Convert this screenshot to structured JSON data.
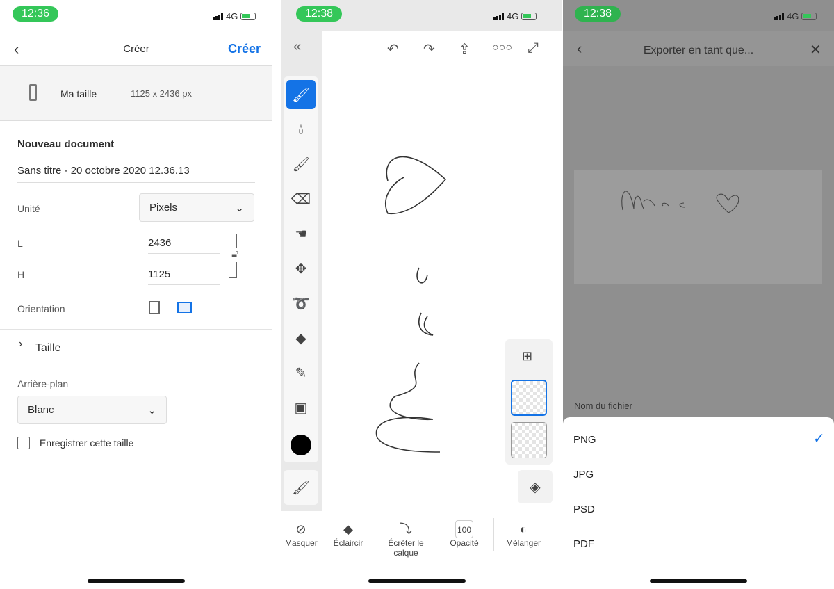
{
  "left": {
    "time": "12:36",
    "network": "4G",
    "back_icon": "chevron-left",
    "title": "Créer",
    "create_label": "Créer",
    "preset": {
      "label": "Ma taille",
      "size": "1125 x 2436 px"
    },
    "section_title": "Nouveau document",
    "doc_name": "Sans titre - 20 octobre 2020 12.36.13",
    "unit_label": "Unité",
    "unit_value": "Pixels",
    "width_label": "L",
    "width_value": "2436",
    "height_label": "H",
    "height_value": "1125",
    "orientation_label": "Orientation",
    "orientation_selected": "landscape",
    "size_label": "Taille",
    "background_label": "Arrière-plan",
    "background_value": "Blanc",
    "save_size_label": "Enregistrer cette taille",
    "save_size_checked": false
  },
  "middle": {
    "time": "12:38",
    "network": "4G",
    "tools": [
      "brush",
      "paint-brush",
      "mixer-brush",
      "eraser",
      "smudge",
      "move",
      "lasso",
      "fill",
      "eyedropper",
      "image"
    ],
    "active_tool": "brush",
    "color": "#000000",
    "bottom": {
      "mask": "Masquer",
      "lighten": "Éclaircir",
      "clip": "Écrêter le calque",
      "opacity_value": "100",
      "opacity": "Opacité",
      "blend": "Mélanger"
    }
  },
  "right": {
    "time": "12:38",
    "network": "4G",
    "title": "Exporter en tant que...",
    "filename_label": "Nom du fichier",
    "formats": [
      "PNG",
      "JPG",
      "PSD",
      "PDF"
    ],
    "selected_format": "PNG"
  },
  "colors": {
    "accent": "#1473e6",
    "status_green": "#34c759"
  }
}
